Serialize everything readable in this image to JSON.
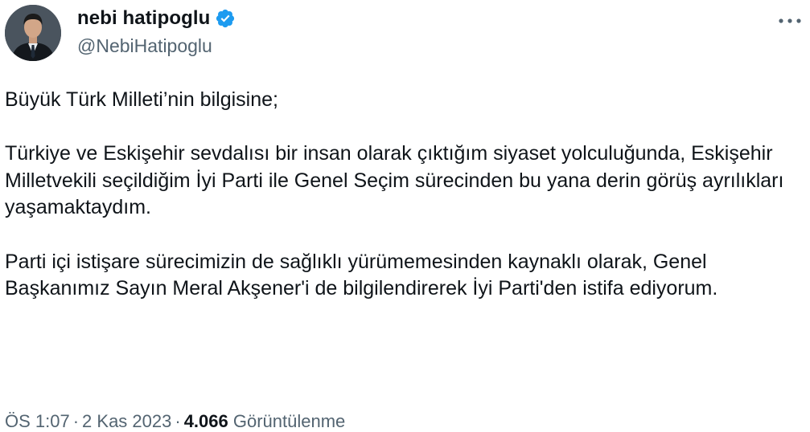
{
  "author": {
    "display_name": "nebi hatipoglu",
    "handle": "@NebiHatipoglu",
    "verified": true,
    "verified_color": "#1d9bf0",
    "avatar_icon": "profile-photo"
  },
  "menu": {
    "more_icon": "more-horizontal-icon"
  },
  "tweet": {
    "paragraphs": [
      "Büyük Türk Milleti’nin bilgisine;",
      "Türkiye ve Eskişehir sevdalısı bir insan olarak çıktığım siyaset yolculuğunda, Eskişehir Milletvekili seçildiğim İyi Parti ile Genel Seçim sürecinden bu yana derin görüş ayrılıkları yaşamaktaydım.",
      "Parti içi istişare sürecimizin de sağlıklı yürümemesinden kaynaklı olarak, Genel Başkanımız Sayın Meral Akşener'i de bilgilendirerek İyi Parti'den istifa ediyorum."
    ]
  },
  "meta": {
    "time": "ÖS 1:07",
    "separator": "·",
    "date": "2 Kas 2023",
    "views_count": "4.066",
    "views_label": "Görüntülenme"
  }
}
